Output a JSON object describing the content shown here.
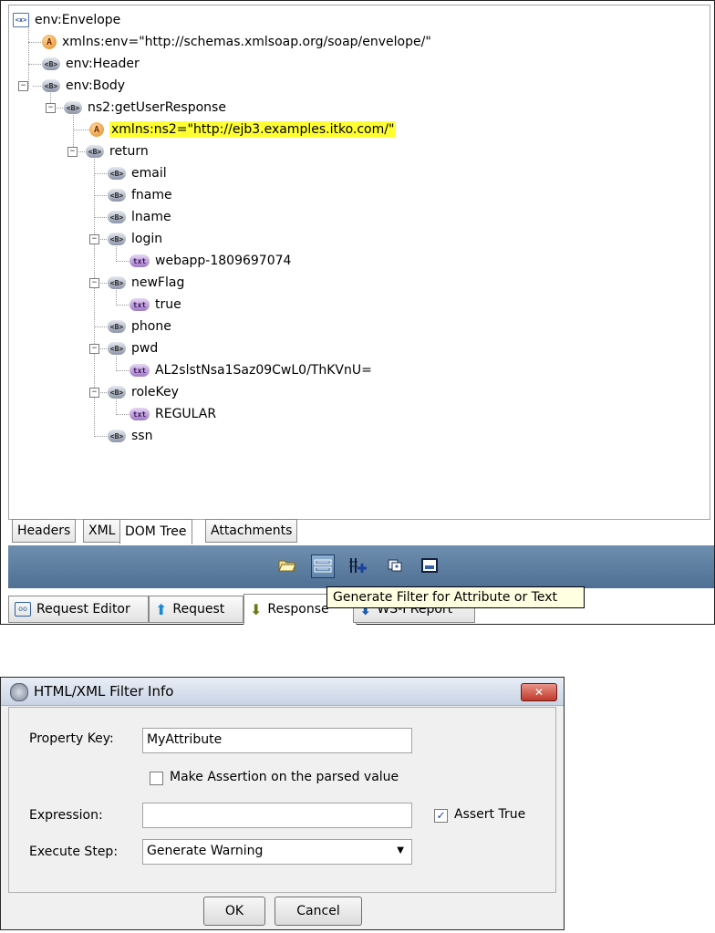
{
  "tree": {
    "root": "env:Envelope",
    "attr_env": "xmlns:env=\"http://schemas.xmlsoap.org/soap/envelope/\"",
    "header": "env:Header",
    "body": "env:Body",
    "response": "ns2:getUserResponse",
    "attr_ns2": "xmlns:ns2=\"http://ejb3.examples.itko.com/\"",
    "return": "return",
    "email": "email",
    "fname": "fname",
    "lname": "lname",
    "login": "login",
    "login_text": "webapp-1809697074",
    "newflag": "newFlag",
    "newflag_text": "true",
    "phone": "phone",
    "pwd": "pwd",
    "pwd_text": "AL2slstNsa1Saz09CwL0/ThKVnU=",
    "rolekey": "roleKey",
    "rolekey_text": "REGULAR",
    "ssn": "ssn",
    "element_badge": "<B>",
    "text_badge": "txt",
    "attr_badge": "A",
    "root_badge": "<x>"
  },
  "view_tabs": [
    "Headers",
    "XML",
    "DOM Tree",
    "Attachments"
  ],
  "toolbar": {
    "tooltip": "Generate Filter for Attribute or Text"
  },
  "bottom_tabs": [
    "Request Editor",
    "Request",
    "Response",
    "WS-I Report"
  ],
  "dialog": {
    "title": "HTML/XML Filter Info",
    "property_key_label": "Property Key:",
    "property_key_value": "MyAttribute",
    "assertion_checkbox_label": "Make Assertion on the parsed value",
    "expression_label": "Expression:",
    "expression_value": "",
    "assert_true_label": "Assert True",
    "execute_step_label": "Execute Step:",
    "execute_step_value": "Generate Warning",
    "ok_label": "OK",
    "cancel_label": "Cancel",
    "close_glyph": "✕"
  },
  "colors": {
    "highlight": "#ffff33",
    "toolbar": "#5f7fa3",
    "tooltip_bg": "#ffffe1"
  }
}
